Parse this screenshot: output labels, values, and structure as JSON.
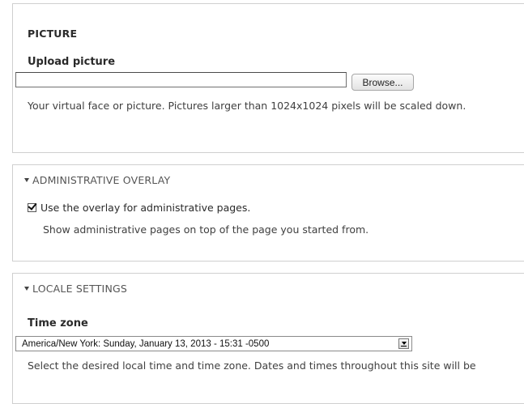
{
  "picture": {
    "legend": "PICTURE",
    "upload_label": "Upload picture",
    "browse_label": "Browse...",
    "description": "Your virtual face or picture. Pictures larger than 1024x1024 pixels will be scaled down."
  },
  "overlay": {
    "legend": "ADMINISTRATIVE OVERLAY",
    "checkbox_label": "Use the overlay for administrative pages.",
    "checked": true,
    "description": "Show administrative pages on top of the page you started from."
  },
  "locale": {
    "legend": "LOCALE SETTINGS",
    "timezone_label": "Time zone",
    "timezone_value": "America/New York: Sunday, January 13, 2013 - 15:31 -0500",
    "description": "Select the desired local time and time zone. Dates and times throughout this site will be"
  }
}
